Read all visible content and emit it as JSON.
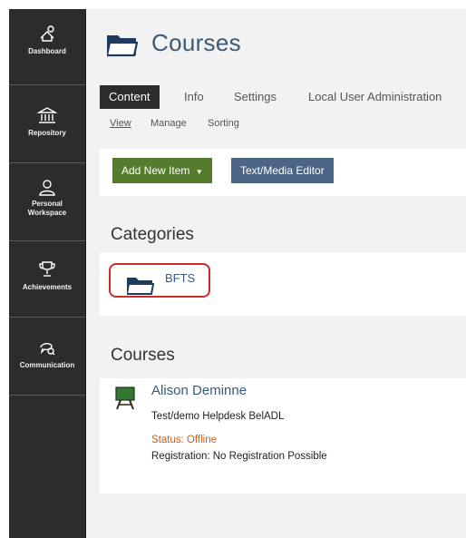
{
  "sidebar": {
    "items": [
      {
        "label": "Dashboard",
        "icon": "dashboard-icon"
      },
      {
        "label": "Repository",
        "icon": "repository-icon"
      },
      {
        "label": "Personal Workspace",
        "icon": "personal-workspace-icon"
      },
      {
        "label": "Achievements",
        "icon": "trophy-icon"
      },
      {
        "label": "Communication",
        "icon": "communication-icon"
      }
    ]
  },
  "header": {
    "title": "Courses",
    "icon": "folder-icon"
  },
  "tabs": [
    {
      "label": "Content",
      "active": true
    },
    {
      "label": "Info"
    },
    {
      "label": "Settings"
    },
    {
      "label": "Local User Administration"
    }
  ],
  "subtabs": [
    {
      "label": "View",
      "active": true
    },
    {
      "label": "Manage"
    },
    {
      "label": "Sorting"
    }
  ],
  "toolbar": {
    "add_new_item": "Add New Item",
    "text_media_editor": "Text/Media Editor"
  },
  "categories": {
    "heading": "Categories",
    "items": [
      {
        "label": "BFTS",
        "icon": "folder-icon"
      }
    ]
  },
  "courses": {
    "heading": "Courses",
    "items": [
      {
        "title": "Alison Deminne",
        "description": "Test/demo Helpdesk BelADL",
        "status": "Status: Offline",
        "registration": "Registration: No Registration Possible",
        "icon": "course-board-icon"
      }
    ]
  },
  "colors": {
    "sidebar_bg": "#2c2c2c",
    "title_blue": "#3a5a78",
    "button_green": "#557b2e",
    "button_blue": "#4c6586",
    "status_orange": "#c0611b",
    "highlight_red": "#cc2b2b"
  }
}
